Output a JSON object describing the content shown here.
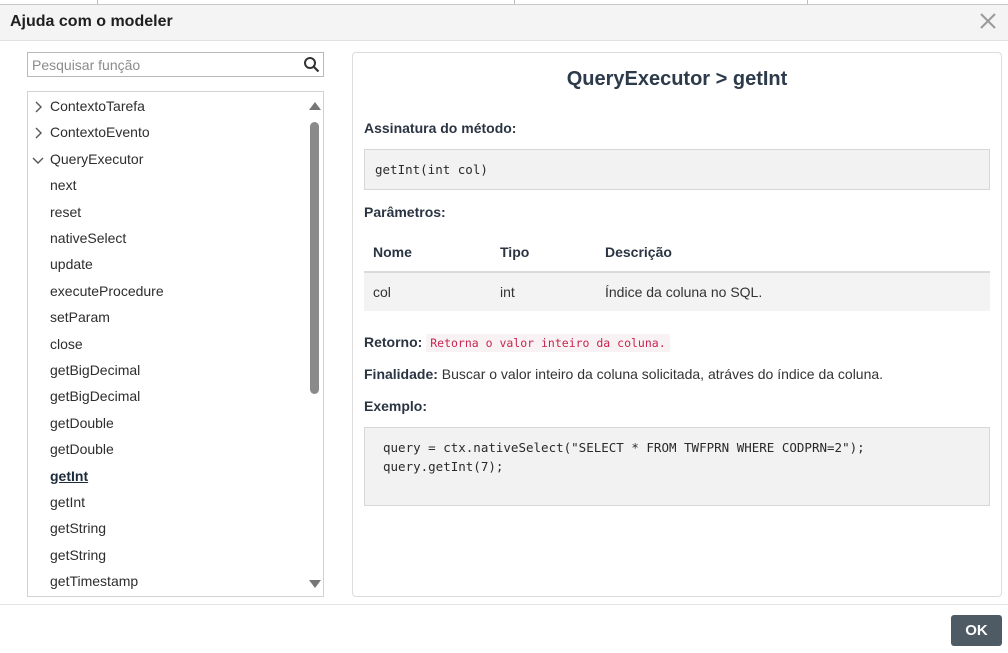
{
  "dialog": {
    "title": "Ajuda com o modeler",
    "ok_label": "OK"
  },
  "search": {
    "placeholder": "Pesquisar função",
    "value": ""
  },
  "tree": {
    "groups": [
      {
        "label": "ContextoTarefa",
        "expanded": false
      },
      {
        "label": "ContextoEvento",
        "expanded": false
      },
      {
        "label": "QueryExecutor",
        "expanded": true
      }
    ],
    "methods": [
      "next",
      "reset",
      "nativeSelect",
      "update",
      "executeProcedure",
      "setParam",
      "close",
      "getBigDecimal",
      "getBigDecimal",
      "getDouble",
      "getDouble",
      "getInt",
      "getInt",
      "getString",
      "getString",
      "getTimestamp"
    ],
    "selected_index": 11
  },
  "detail": {
    "title": "QueryExecutor > getInt",
    "signature_label": "Assinatura do método:",
    "signature": "getInt(int col)",
    "params_label": "Parâmetros:",
    "params_headers": [
      "Nome",
      "Tipo",
      "Descrição"
    ],
    "params_rows": [
      [
        "col",
        "int",
        "Índice da coluna no SQL."
      ]
    ],
    "return_label": "Retorno:",
    "return_value": "Retorna o valor inteiro da coluna.",
    "purpose_label": "Finalidade:",
    "purpose_value": "Buscar o valor inteiro da coluna solicitada, atráves do índice da coluna.",
    "example_label": "Exemplo:",
    "example_lines": [
      "query = ctx.nativeSelect(\"SELECT * FROM TWFPRN WHERE CODPRN=2\");",
      "query.getInt(7);"
    ]
  },
  "colors": {
    "title_bar": "#f4f4f4",
    "ok_button": "#4e5a64",
    "return_code": "#c7254e",
    "scroll_thumb": "#8a8a8a"
  },
  "icons": {
    "search": "magnifier-icon",
    "close": "close-x-icon",
    "collapsed": "chevron-right-icon",
    "expanded": "chevron-down-icon"
  }
}
